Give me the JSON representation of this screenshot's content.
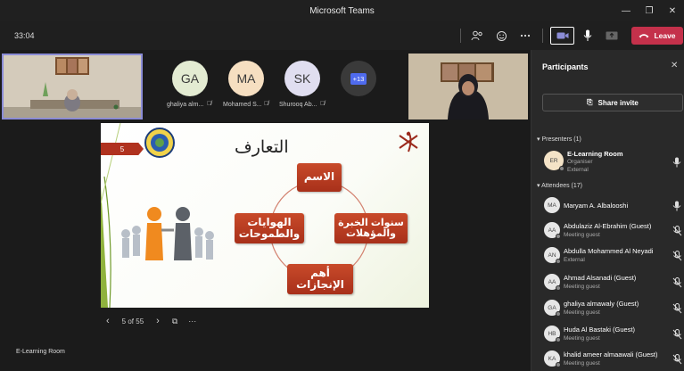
{
  "window": {
    "title": "Microsoft Teams"
  },
  "toolbar": {
    "timer": "33:04",
    "leave_label": "Leave"
  },
  "stage": {
    "avatars": [
      {
        "initials": "GA",
        "name": "ghaliya alm...",
        "color": "#e3ebd2"
      },
      {
        "initials": "MA",
        "name": "Mohamed S...",
        "color": "#f6dfc1"
      },
      {
        "initials": "SK",
        "name": "Shurooq Ab...",
        "color": "#e0def0"
      },
      {
        "initials": "+13",
        "name": "",
        "color": "#3a3a3a"
      }
    ],
    "slide": {
      "number": "5",
      "title": "التعارف",
      "boxes": {
        "name": "الاسم",
        "experience": "سنوات الخبرة والمؤهلات",
        "achievements": "أهم الإنجازات",
        "hobbies": "الهوايات والطموحات"
      }
    },
    "slide_counter": "5 of 55",
    "footer_name": "E-Learning Room"
  },
  "panel": {
    "title": "Participants",
    "share_label": "Share invite",
    "presenters_label": "Presenters (1)",
    "attendees_label": "Attendees (17)",
    "presenter": {
      "initials": "ER",
      "name": "E-Learning Room",
      "sub1": "Organiser",
      "sub2": "External"
    },
    "attendees": [
      {
        "initials": "MA",
        "name": "Maryam A. Albalooshi",
        "sub": "",
        "muted": false
      },
      {
        "initials": "AA",
        "name": "Abdulaziz Al-Ebrahim (Guest)",
        "sub": "Meeting guest",
        "muted": true
      },
      {
        "initials": "AN",
        "name": "Abdulla Mohammed Al Neyadi",
        "sub": "External",
        "muted": true
      },
      {
        "initials": "AA",
        "name": "Ahmad Alsanadi (Guest)",
        "sub": "Meeting guest",
        "muted": true
      },
      {
        "initials": "GA",
        "name": "ghaliya almawaly (Guest)",
        "sub": "Meeting guest",
        "muted": true
      },
      {
        "initials": "HB",
        "name": "Huda Al Bastaki (Guest)",
        "sub": "Meeting guest",
        "muted": true
      },
      {
        "initials": "KA",
        "name": "khalid ameer almaawali (Guest)",
        "sub": "Meeting guest",
        "muted": true
      }
    ]
  }
}
